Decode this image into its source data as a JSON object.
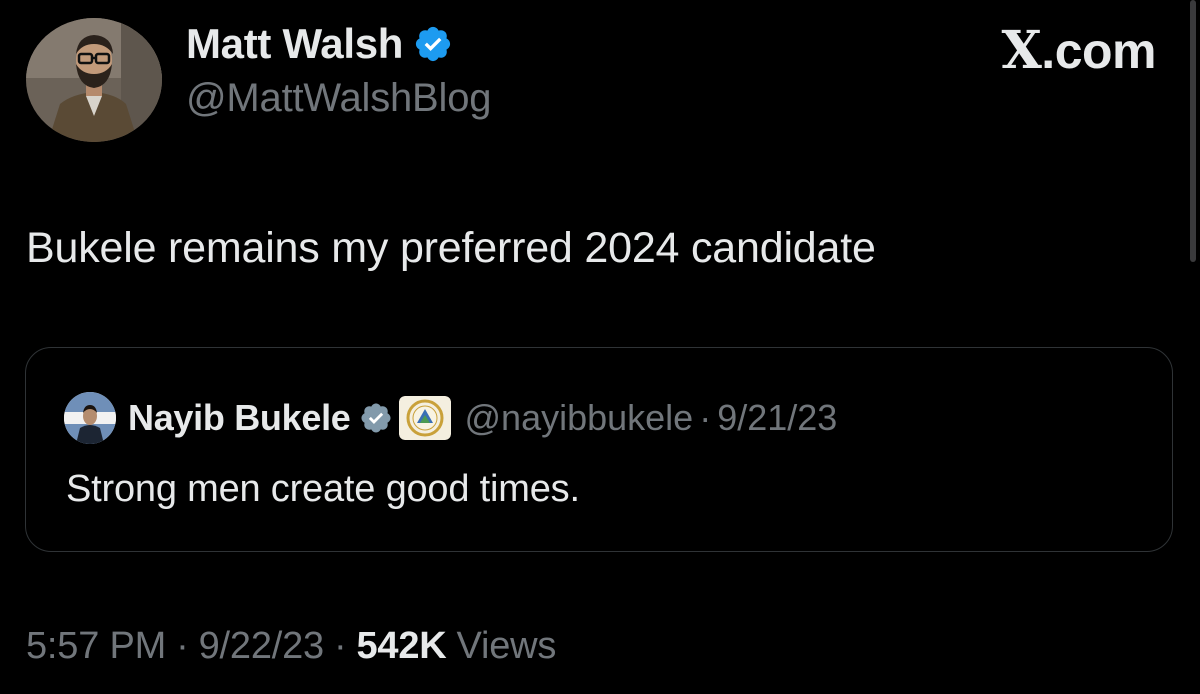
{
  "author": {
    "name": "Matt Walsh",
    "handle": "@MattWalshBlog",
    "verified": true
  },
  "brand": {
    "label": ".com",
    "logo": "X"
  },
  "tweet": {
    "text": "Bukele remains my preferred 2024 candidate"
  },
  "quote": {
    "name": "Nayib Bukele",
    "handle": "@nayibbukele",
    "separator": "·",
    "date": "9/21/23",
    "text": "Strong men create good times.",
    "verified": true,
    "affiliate_badge": "el-salvador-coat-of-arms-icon"
  },
  "meta": {
    "time": "5:57 PM",
    "separator": "·",
    "date": "9/22/23",
    "views_count": "542K",
    "views_label": "Views"
  },
  "colors": {
    "background": "#000000",
    "primary_text": "#e7e9ea",
    "secondary_text": "#71767b",
    "verified_blue": "#1d9bf0",
    "verified_gray": "#829aab",
    "border": "#2f3336"
  }
}
